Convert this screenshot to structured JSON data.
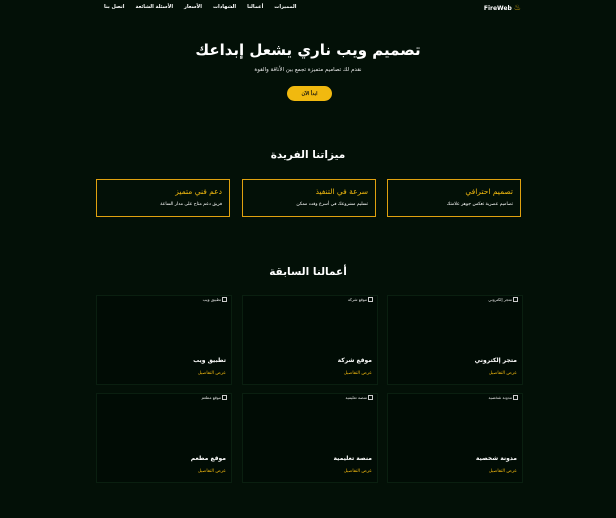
{
  "brand": {
    "name": "FireWeb"
  },
  "nav": {
    "items": [
      "المميزات",
      "أعمالنا",
      "الشهادات",
      "الأسعار",
      "الأسئلة الشائعة",
      "اتصل بنا"
    ]
  },
  "hero": {
    "title": "تصميم ويب ناري يشعل إبداعك",
    "subtitle": "نقدم لك تصاميم متميزة تجمع بين الأناقة والقوة",
    "cta": "ابدأ الآن"
  },
  "features": {
    "title": "ميزاتنا الفريدة",
    "items": [
      {
        "title": "تصميم احترافي",
        "desc": "تصاميم عصرية تعكس جوهر علامتك"
      },
      {
        "title": "سرعة في التنفيذ",
        "desc": "تسليم مشروعك في أسرع وقت ممكن"
      },
      {
        "title": "دعم فني متميز",
        "desc": "فريق دعم متاح على مدار الساعة"
      }
    ]
  },
  "portfolio": {
    "title": "أعمالنا السابقة",
    "link_label": "عرض التفاصيل",
    "items": [
      {
        "alt": "متجر إلكتروني",
        "title": "متجر إلكتروني"
      },
      {
        "alt": "موقع شركة",
        "title": "موقع شركة"
      },
      {
        "alt": "تطبيق ويب",
        "title": "تطبيق ويب"
      },
      {
        "alt": "مدونة شخصية",
        "title": "مدونة شخصية"
      },
      {
        "alt": "منصة تعليمية",
        "title": "منصة تعليمية"
      },
      {
        "alt": "موقع مطعم",
        "title": "موقع مطعم"
      }
    ]
  },
  "colors": {
    "background": "#031007",
    "accent": "#f1b90f",
    "card": "#010c05"
  },
  "icons": {
    "logo": "flame-icon",
    "image_placeholder": "broken-image-icon"
  }
}
